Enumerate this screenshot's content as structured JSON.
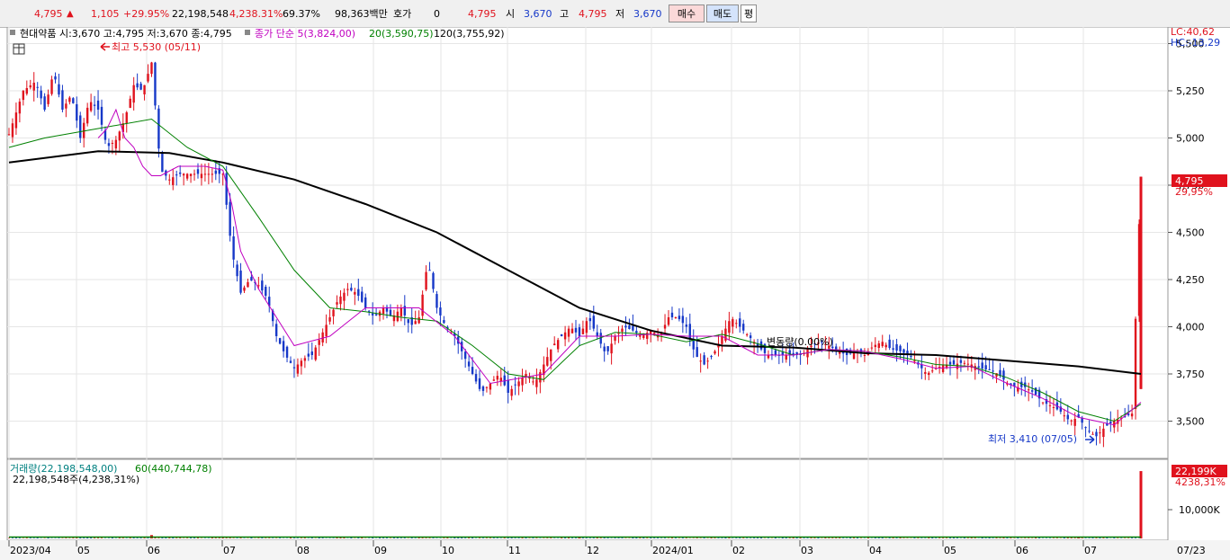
{
  "header": {
    "price": "4,795",
    "change": "1,105",
    "change_pct": "+29.95%",
    "volume": "22,198,548",
    "volume_ratio": "4,238.31%",
    "turnover": "69.37%",
    "amount": "98,363백만",
    "quote_label": "호가",
    "quote_value": "0",
    "quote_price": "4,795",
    "open_label": "시",
    "open": "3,670",
    "high_label": "고",
    "high": "4,795",
    "low_label": "저",
    "low": "3,670",
    "buy_button": "매수",
    "sell_button": "매도",
    "avg_button": "평"
  },
  "price_panel": {
    "stock_info": "현대약품 시:3,670 고:4,795 저:3,670 종:4,795",
    "ma_label": "종가 단순 5(3,824,00)",
    "ma20_label": "20(3,590,75)",
    "ma120_label": "120(3,755,92)",
    "high_annotation": "최고 5,530 (05/11)",
    "low_annotation": "최저 3,410 (07/05)",
    "mid_annotation": "변동량(0.00%)",
    "lc": "LC:40,62",
    "hc": "HC:-13,29",
    "current_price_tag": "4,795",
    "current_pct_tag": "29,95%",
    "y_ticks": [
      "5,500",
      "5,250",
      "5,000",
      "4,750",
      "4,500",
      "4,250",
      "4,000",
      "3,750",
      "3,500"
    ]
  },
  "volume_panel": {
    "label": "거래량(22,198,548,00)",
    "ma_label": "60(440,744,78)",
    "sub_label": "22,198,548주(4,238,31%)",
    "current_tag": "22,199K",
    "current_pct": "4238,31%",
    "y_tick": "10,000K"
  },
  "x_axis": {
    "labels": [
      "2023/04",
      "05",
      "06",
      "07",
      "08",
      "09",
      "10",
      "11",
      "12",
      "2024/01",
      "02",
      "03",
      "04",
      "05",
      "06",
      "07",
      "07/23"
    ]
  },
  "colors": {
    "up": "#e0121d",
    "down": "#1638c8",
    "ma5": "#c000c0",
    "ma20": "#008000",
    "ma120": "#000000",
    "volume_ma": "#008000"
  },
  "chart_data": {
    "type": "candlestick",
    "x_labels": [
      "2023/04",
      "05",
      "06",
      "07",
      "08",
      "09",
      "10",
      "11",
      "12",
      "2024/01",
      "02",
      "03",
      "04",
      "05",
      "06",
      "07"
    ],
    "close_path": [
      [
        0,
        5020
      ],
      [
        8,
        5250
      ],
      [
        15,
        5300
      ],
      [
        20,
        5150
      ],
      [
        25,
        5350
      ],
      [
        30,
        5150
      ],
      [
        35,
        5230
      ],
      [
        40,
        5000
      ],
      [
        45,
        5200
      ],
      [
        50,
        5150
      ],
      [
        55,
        4950
      ],
      [
        60,
        4990
      ],
      [
        65,
        5100
      ],
      [
        70,
        5280
      ],
      [
        75,
        5250
      ],
      [
        80,
        5400
      ],
      [
        85,
        4830
      ],
      [
        90,
        4780
      ],
      [
        95,
        4810
      ],
      [
        100,
        4810
      ],
      [
        105,
        4810
      ],
      [
        110,
        4810
      ],
      [
        115,
        4810
      ],
      [
        120,
        4810
      ],
      [
        125,
        4400
      ],
      [
        130,
        4180
      ],
      [
        135,
        4250
      ],
      [
        140,
        4220
      ],
      [
        145,
        4150
      ],
      [
        150,
        3950
      ],
      [
        155,
        3850
      ],
      [
        160,
        3780
      ],
      [
        165,
        3830
      ],
      [
        170,
        3850
      ],
      [
        175,
        3950
      ],
      [
        180,
        4050
      ],
      [
        185,
        4150
      ],
      [
        190,
        4200
      ],
      [
        195,
        4180
      ],
      [
        200,
        4100
      ],
      [
        205,
        4050
      ],
      [
        210,
        4100
      ],
      [
        215,
        4050
      ],
      [
        220,
        4100
      ],
      [
        225,
        4000
      ],
      [
        230,
        4050
      ],
      [
        235,
        4350
      ],
      [
        240,
        4100
      ],
      [
        245,
        4000
      ],
      [
        250,
        3950
      ],
      [
        255,
        3850
      ],
      [
        260,
        3750
      ],
      [
        265,
        3650
      ],
      [
        270,
        3700
      ],
      [
        275,
        3750
      ],
      [
        280,
        3650
      ],
      [
        285,
        3700
      ],
      [
        290,
        3750
      ],
      [
        295,
        3700
      ],
      [
        300,
        3800
      ],
      [
        305,
        3900
      ],
      [
        310,
        3950
      ],
      [
        315,
        4000
      ],
      [
        320,
        3950
      ],
      [
        325,
        4050
      ],
      [
        330,
        3950
      ],
      [
        335,
        3850
      ],
      [
        340,
        3950
      ],
      [
        345,
        4000
      ],
      [
        350,
        3980
      ],
      [
        355,
        3950
      ],
      [
        360,
        3980
      ],
      [
        365,
        3950
      ],
      [
        370,
        4050
      ],
      [
        375,
        4050
      ],
      [
        380,
        4000
      ],
      [
        385,
        3850
      ],
      [
        390,
        3800
      ],
      [
        395,
        3850
      ],
      [
        400,
        3950
      ],
      [
        405,
        4050
      ],
      [
        410,
        4000
      ],
      [
        415,
        3950
      ],
      [
        420,
        3900
      ],
      [
        425,
        3850
      ],
      [
        430,
        3850
      ],
      [
        435,
        3850
      ],
      [
        440,
        3850
      ],
      [
        445,
        3850
      ],
      [
        450,
        3900
      ],
      [
        455,
        3920
      ],
      [
        460,
        3900
      ],
      [
        465,
        3870
      ],
      [
        470,
        3850
      ],
      [
        475,
        3870
      ],
      [
        480,
        3850
      ],
      [
        485,
        3900
      ],
      [
        490,
        3920
      ],
      [
        495,
        3880
      ],
      [
        500,
        3870
      ],
      [
        505,
        3850
      ],
      [
        510,
        3800
      ],
      [
        515,
        3750
      ],
      [
        520,
        3780
      ],
      [
        525,
        3800
      ],
      [
        530,
        3800
      ],
      [
        535,
        3810
      ],
      [
        540,
        3800
      ],
      [
        545,
        3780
      ],
      [
        550,
        3770
      ],
      [
        555,
        3750
      ],
      [
        560,
        3700
      ],
      [
        565,
        3680
      ],
      [
        570,
        3680
      ],
      [
        575,
        3650
      ],
      [
        580,
        3600
      ],
      [
        585,
        3580
      ],
      [
        590,
        3550
      ],
      [
        595,
        3500
      ],
      [
        600,
        3520
      ],
      [
        605,
        3450
      ],
      [
        610,
        3420
      ],
      [
        615,
        3470
      ],
      [
        620,
        3500
      ],
      [
        625,
        3520
      ],
      [
        630,
        3540
      ],
      [
        635,
        4795
      ]
    ],
    "ma20_path": [
      [
        0,
        4950
      ],
      [
        20,
        5000
      ],
      [
        50,
        5050
      ],
      [
        80,
        5100
      ],
      [
        100,
        4950
      ],
      [
        120,
        4850
      ],
      [
        140,
        4580
      ],
      [
        160,
        4300
      ],
      [
        180,
        4100
      ],
      [
        200,
        4080
      ],
      [
        220,
        4050
      ],
      [
        240,
        4030
      ],
      [
        260,
        3900
      ],
      [
        280,
        3750
      ],
      [
        300,
        3720
      ],
      [
        320,
        3900
      ],
      [
        340,
        3970
      ],
      [
        360,
        3960
      ],
      [
        380,
        3920
      ],
      [
        400,
        3960
      ],
      [
        420,
        3910
      ],
      [
        440,
        3850
      ],
      [
        460,
        3880
      ],
      [
        480,
        3870
      ],
      [
        500,
        3840
      ],
      [
        520,
        3800
      ],
      [
        540,
        3790
      ],
      [
        560,
        3730
      ],
      [
        580,
        3650
      ],
      [
        600,
        3550
      ],
      [
        620,
        3500
      ],
      [
        635,
        3590
      ]
    ],
    "ma120_path": [
      [
        0,
        4870
      ],
      [
        50,
        4930
      ],
      [
        90,
        4920
      ],
      [
        120,
        4870
      ],
      [
        160,
        4780
      ],
      [
        200,
        4650
      ],
      [
        240,
        4500
      ],
      [
        280,
        4300
      ],
      [
        320,
        4100
      ],
      [
        360,
        3980
      ],
      [
        400,
        3900
      ],
      [
        440,
        3890
      ],
      [
        480,
        3860
      ],
      [
        520,
        3850
      ],
      [
        560,
        3820
      ],
      [
        600,
        3790
      ],
      [
        635,
        3750
      ]
    ],
    "ma5_path": [
      [
        50,
        5000
      ],
      [
        55,
        5050
      ],
      [
        60,
        5150
      ],
      [
        65,
        5000
      ],
      [
        70,
        4950
      ],
      [
        75,
        4850
      ],
      [
        80,
        4800
      ],
      [
        85,
        4800
      ],
      [
        95,
        4850
      ],
      [
        100,
        4850
      ],
      [
        110,
        4850
      ],
      [
        120,
        4830
      ],
      [
        125,
        4650
      ],
      [
        130,
        4400
      ],
      [
        140,
        4200
      ],
      [
        160,
        3900
      ],
      [
        180,
        3950
      ],
      [
        200,
        4100
      ],
      [
        230,
        4100
      ],
      [
        250,
        3950
      ],
      [
        270,
        3700
      ],
      [
        300,
        3750
      ],
      [
        320,
        3950
      ],
      [
        340,
        3950
      ],
      [
        360,
        3960
      ],
      [
        380,
        3950
      ],
      [
        400,
        3950
      ],
      [
        420,
        3850
      ],
      [
        440,
        3850
      ],
      [
        460,
        3880
      ],
      [
        480,
        3870
      ],
      [
        500,
        3830
      ],
      [
        520,
        3780
      ],
      [
        540,
        3790
      ],
      [
        560,
        3700
      ],
      [
        580,
        3620
      ],
      [
        600,
        3520
      ],
      [
        620,
        3480
      ],
      [
        635,
        3600
      ]
    ],
    "volume_spikes": [
      [
        80,
        1100
      ],
      [
        320,
        300
      ],
      [
        600,
        500
      ],
      [
        635,
        22199
      ]
    ],
    "high": {
      "value": 5530,
      "date": "05/11"
    },
    "low": {
      "value": 3410,
      "date": "07/05"
    },
    "last_price": 4795,
    "y_range": [
      3350,
      5550
    ],
    "volume_range": [
      0,
      24000
    ]
  }
}
